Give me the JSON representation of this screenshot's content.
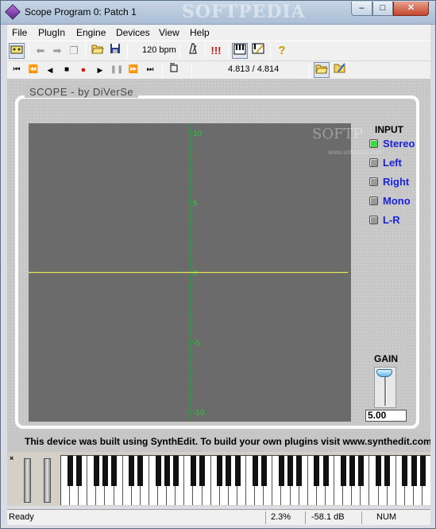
{
  "window": {
    "title": "Scope Program 0: Patch 1",
    "watermark": "SOFTPEDIA",
    "min_symbol": "–",
    "max_symbol": "□",
    "close_symbol": "✕"
  },
  "menu": [
    "File",
    "PlugIn",
    "Engine",
    "Devices",
    "View",
    "Help"
  ],
  "toolbar": {
    "bpm": "120 bpm",
    "alert": "!!!",
    "help": "?",
    "position": "4.813 / 4.814"
  },
  "scope": {
    "section_title": "SCOPE  - by DiVerSe",
    "watermark": "SOFTP",
    "watermark_small": "www.softpedia.com",
    "y_ticks": [
      "10",
      "5",
      "0",
      "-5",
      "-10"
    ],
    "trace_color": "#e8e85a",
    "axis_color": "#2b9a3a"
  },
  "input": {
    "title": "INPUT",
    "options": [
      {
        "label": "Stereo",
        "selected": true
      },
      {
        "label": "Left",
        "selected": false
      },
      {
        "label": "Right",
        "selected": false
      },
      {
        "label": "Mono",
        "selected": false
      },
      {
        "label": "L-R",
        "selected": false
      }
    ]
  },
  "gain": {
    "title": "GAIN",
    "value": "5.00"
  },
  "banner": "This device was built using SynthEdit.  To build your own plugins visit www.synthedit.com",
  "keyboard": {
    "close_symbol": "×"
  },
  "status": {
    "text": "Ready",
    "cpu": "2.3%",
    "level": "-58.1 dB",
    "numlock": "NUM"
  }
}
